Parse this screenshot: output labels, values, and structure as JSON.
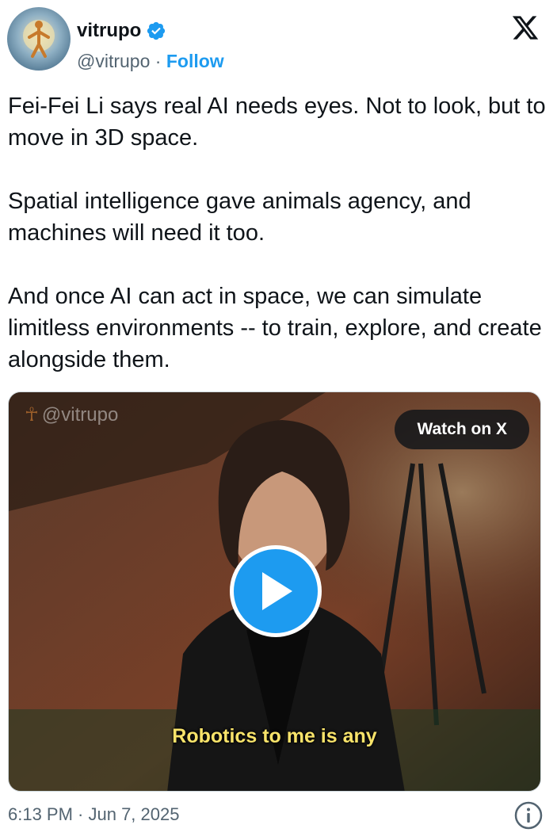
{
  "author": {
    "display_name": "vitrupo",
    "handle": "@vitrupo",
    "separator": "·",
    "follow_label": "Follow",
    "verified": true,
    "accent_color": "#1d9bf0"
  },
  "tweet": {
    "text": "Fei-Fei Li says real AI needs eyes. Not to look, but to move in 3D space.\n\nSpatial intelligence gave animals agency, and machines will need it too.\n\nAnd once AI can act in space, we can simulate limitless environments -- to train, explore, and create alongside them."
  },
  "media": {
    "watermark": "@vitrupo",
    "watch_label": "Watch on X",
    "caption": "Robotics to me is any"
  },
  "footer": {
    "timestamp": "6:13 PM · Jun 7, 2025"
  },
  "icons": {
    "logo": "x-logo-icon",
    "verified": "verified-badge-icon",
    "play": "play-icon",
    "info": "info-icon"
  }
}
